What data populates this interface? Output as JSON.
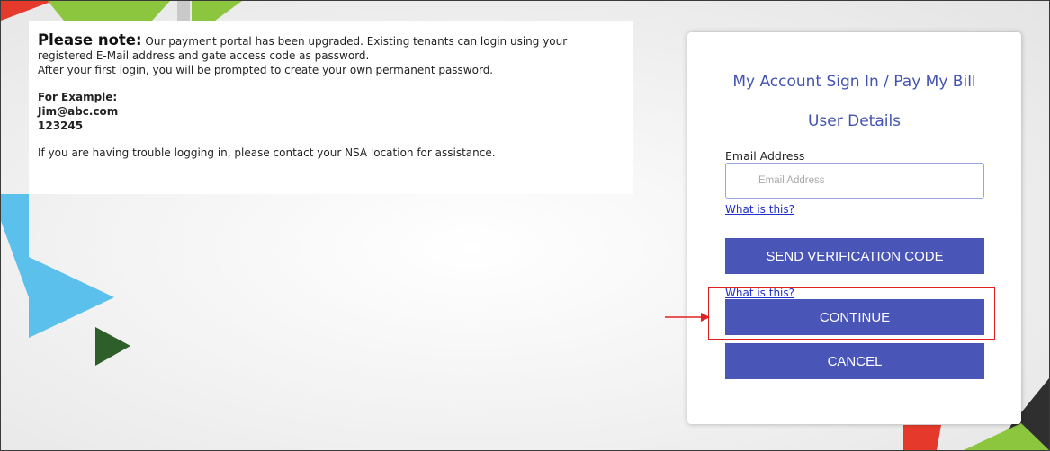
{
  "notice": {
    "lead": "Please note:",
    "line1": " Our payment portal has been upgraded. Existing tenants can login using your registered E-Mail address and gate access code as password.",
    "line2": "After your first login, you will be prompted to create your own permanent password.",
    "example_heading": "For Example:",
    "example_email": "Jim@abc.com",
    "example_code": "123245",
    "help": "If you are having trouble logging in, please contact your NSA location for assistance."
  },
  "card": {
    "title": "My Account Sign In / Pay My Bill",
    "subtitle": "User Details",
    "email_label": "Email Address",
    "email_value": "",
    "email_placeholder": "Email Address",
    "help_link_1": "What is this?",
    "send_code_button": "SEND VERIFICATION CODE",
    "help_link_2": "What is this?",
    "continue_button": "CONTINUE",
    "cancel_button": "CANCEL"
  },
  "colors": {
    "accent": "#4a55b8",
    "title": "#4453b0",
    "link": "#2230cc",
    "highlight": "#e02020",
    "shape_red": "#e53a2b",
    "shape_green": "#8cc63f",
    "shape_blue": "#5bc0eb",
    "shape_dark_green": "#2e5e2a",
    "shape_dark": "#2f2f2f"
  }
}
